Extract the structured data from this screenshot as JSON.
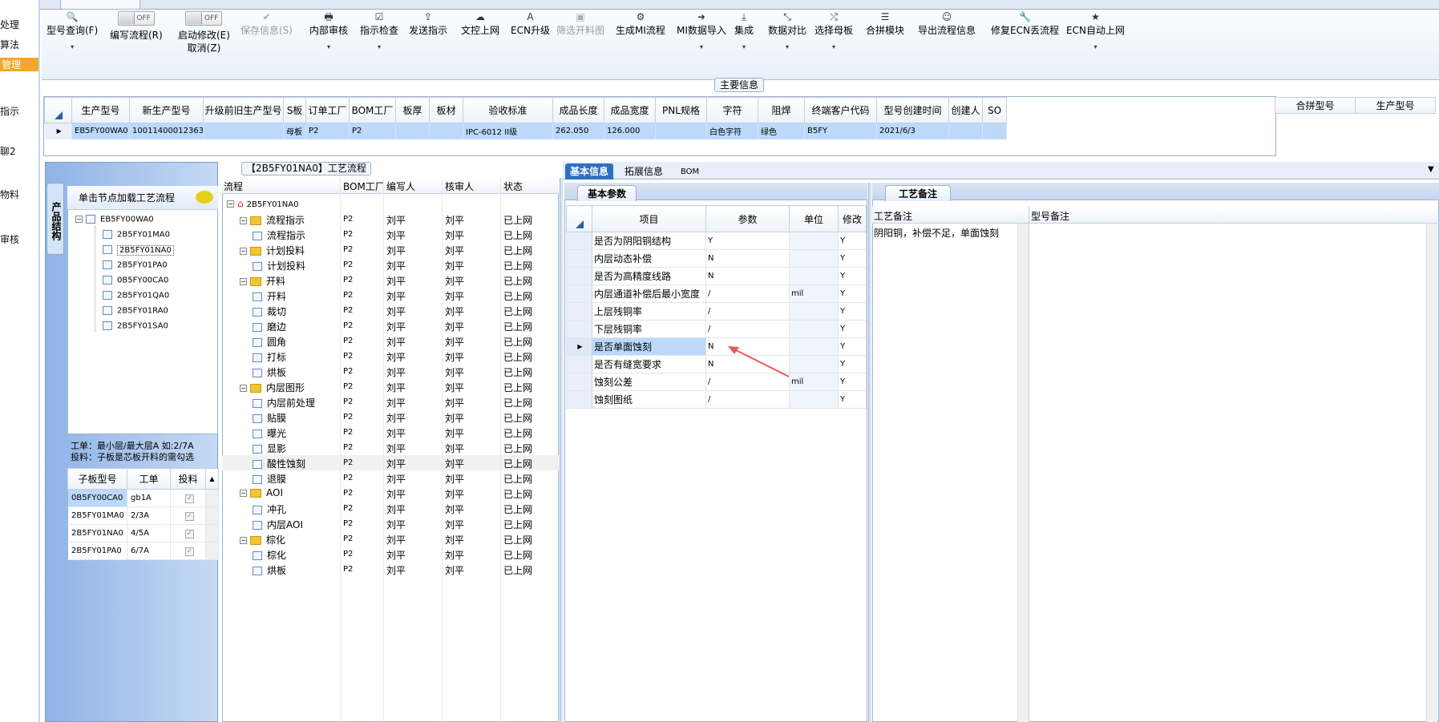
{
  "leftnav": {
    "items": [
      "处理",
      "算法",
      "管理",
      "指示",
      "聊2",
      "物料",
      "审核"
    ],
    "selected": "管理"
  },
  "toolbar": {
    "buttons": [
      {
        "icon": "search-icon",
        "glyph": "🔍",
        "label": "型号查询(F)",
        "arrow": "▾"
      },
      {
        "icon": "toggle",
        "glyph": "OFF",
        "label": "编写流程(R)"
      },
      {
        "icon": "toggle",
        "glyph": "OFF",
        "label": "启动修改(E)",
        "label2": "取消(Z)"
      },
      {
        "icon": "check-icon",
        "glyph": "✔",
        "label": "保存信息(S)",
        "disabled": true
      },
      {
        "icon": "print-icon",
        "glyph": "🖶",
        "label": "内部审核",
        "arrow": "▾"
      },
      {
        "icon": "checkbox-icon",
        "glyph": "☑",
        "label": "指示检查",
        "arrow": "▾"
      },
      {
        "icon": "upload-icon",
        "glyph": "⇪",
        "label": "发送指示"
      },
      {
        "icon": "cloud-upload-icon",
        "glyph": "☁",
        "label": "文控上网"
      },
      {
        "icon": "font-icon",
        "glyph": "A",
        "label": "ECN升级"
      },
      {
        "icon": "image-icon",
        "glyph": "▣",
        "label": "筛选开料图",
        "disabled": true
      },
      {
        "icon": "gears-icon",
        "glyph": "⚙",
        "label": "生成MI流程"
      },
      {
        "icon": "sign-in-icon",
        "glyph": "➜",
        "label": "MI数据导入",
        "arrow": "▾"
      },
      {
        "icon": "download-icon",
        "glyph": "⤓",
        "label": "集成",
        "arrow": "▾"
      },
      {
        "icon": "compress-icon",
        "glyph": "⤡",
        "label": "数据对比",
        "arrow": "▾"
      },
      {
        "icon": "shuffle-icon",
        "glyph": "⤮",
        "label": "选择母板",
        "arrow": "▾"
      },
      {
        "icon": "list-icon",
        "glyph": "☰",
        "label": "合拼模块"
      },
      {
        "icon": "smile-icon",
        "glyph": "☺",
        "label": "导出流程信息"
      },
      {
        "icon": "wrench-icon",
        "glyph": "🔧",
        "label": "修复ECN丢流程"
      },
      {
        "icon": "star-icon",
        "glyph": "★",
        "label": "ECN自动上网",
        "arrow": "▾"
      }
    ]
  },
  "main_info": {
    "title": "主要信息",
    "columns": [
      "生产型号",
      "新生产型号",
      "升级前旧生产型号",
      "S板",
      "订单工厂",
      "BOM工厂",
      "板厚",
      "板材",
      "验收标准",
      "成品长度",
      "成品宽度",
      "PNL规格",
      "字符",
      "阻焊",
      "终端客户代码",
      "型号创建时间",
      "创建人",
      "SO"
    ],
    "row": [
      "EB5FY00WA0",
      "10011400012363",
      "",
      "母板",
      "P2",
      "P2",
      "",
      "",
      "IPC-6012 II级",
      "262.050",
      "126.000",
      "",
      "白色字符",
      "绿色",
      "B5FY",
      "2021/6/3",
      "",
      ""
    ],
    "side_columns": [
      "合拼型号",
      "生产型号"
    ]
  },
  "struct_panel": {
    "tab_label": "产品结构",
    "hint": "单击节点加载工艺流程",
    "tree": [
      "EB5FY00WA0",
      "2B5FY01MA0",
      "2B5FY01NA0",
      "2B5FY01PA0",
      "0B5FY00CA0",
      "2B5FY01QA0",
      "2B5FY01RA0",
      "2B5FY01SA0"
    ],
    "note_line1": "工单：最小层/最大层A 如:2/7A",
    "note_line2": "投料：子板是芯板开料的需勾选",
    "sub_columns": [
      "子板型号",
      "工单",
      "投料"
    ],
    "sub_rows": [
      [
        "0B5FY00CA0",
        "gb1A"
      ],
      [
        "2B5FY01MA0",
        "2/3A"
      ],
      [
        "2B5FY01NA0",
        "4/5A"
      ],
      [
        "2B5FY01PA0",
        "6/7A"
      ]
    ]
  },
  "flow_panel": {
    "title": "【2B5FY01NA0】工艺流程",
    "columns": [
      "流程",
      "BOM工厂",
      "编写人",
      "核审人",
      "状态"
    ],
    "root": "2B5FY01NA0",
    "rows": [
      {
        "name": "流程指示",
        "level": 1,
        "folder": true,
        "bom": "P2",
        "writer": "刘平",
        "reviewer": "刘平",
        "status": "已上网"
      },
      {
        "name": "流程指示",
        "level": 2,
        "folder": false,
        "bom": "P2",
        "writer": "刘平",
        "reviewer": "刘平",
        "status": "已上网"
      },
      {
        "name": "计划投料",
        "level": 1,
        "folder": true,
        "bom": "P2",
        "writer": "刘平",
        "reviewer": "刘平",
        "status": "已上网"
      },
      {
        "name": "计划投料",
        "level": 2,
        "folder": false,
        "bom": "P2",
        "writer": "刘平",
        "reviewer": "刘平",
        "status": "已上网"
      },
      {
        "name": "开料",
        "level": 1,
        "folder": true,
        "bom": "P2",
        "writer": "刘平",
        "reviewer": "刘平",
        "status": "已上网"
      },
      {
        "name": "开料",
        "level": 2,
        "folder": false,
        "bom": "P2",
        "writer": "刘平",
        "reviewer": "刘平",
        "status": "已上网"
      },
      {
        "name": "裁切",
        "level": 2,
        "folder": false,
        "bom": "P2",
        "writer": "刘平",
        "reviewer": "刘平",
        "status": "已上网"
      },
      {
        "name": "磨边",
        "level": 2,
        "folder": false,
        "bom": "P2",
        "writer": "刘平",
        "reviewer": "刘平",
        "status": "已上网"
      },
      {
        "name": "圆角",
        "level": 2,
        "folder": false,
        "bom": "P2",
        "writer": "刘平",
        "reviewer": "刘平",
        "status": "已上网"
      },
      {
        "name": "打标",
        "level": 2,
        "folder": false,
        "bom": "P2",
        "writer": "刘平",
        "reviewer": "刘平",
        "status": "已上网"
      },
      {
        "name": "烘板",
        "level": 2,
        "folder": false,
        "bom": "P2",
        "writer": "刘平",
        "reviewer": "刘平",
        "status": "已上网"
      },
      {
        "name": "内层图形",
        "level": 1,
        "folder": true,
        "bom": "P2",
        "writer": "刘平",
        "reviewer": "刘平",
        "status": "已上网"
      },
      {
        "name": "内层前处理",
        "level": 2,
        "folder": false,
        "bom": "P2",
        "writer": "刘平",
        "reviewer": "刘平",
        "status": "已上网"
      },
      {
        "name": "贴膜",
        "level": 2,
        "folder": false,
        "bom": "P2",
        "writer": "刘平",
        "reviewer": "刘平",
        "status": "已上网"
      },
      {
        "name": "曝光",
        "level": 2,
        "folder": false,
        "bom": "P2",
        "writer": "刘平",
        "reviewer": "刘平",
        "status": "已上网"
      },
      {
        "name": "显影",
        "level": 2,
        "folder": false,
        "bom": "P2",
        "writer": "刘平",
        "reviewer": "刘平",
        "status": "已上网"
      },
      {
        "name": "酸性蚀刻",
        "level": 2,
        "folder": false,
        "bom": "P2",
        "writer": "刘平",
        "reviewer": "刘平",
        "status": "已上网",
        "selected": true
      },
      {
        "name": "退膜",
        "level": 2,
        "folder": false,
        "bom": "P2",
        "writer": "刘平",
        "reviewer": "刘平",
        "status": "已上网"
      },
      {
        "name": "AOI",
        "level": 1,
        "folder": true,
        "bom": "P2",
        "writer": "刘平",
        "reviewer": "刘平",
        "status": "已上网"
      },
      {
        "name": "冲孔",
        "level": 2,
        "folder": false,
        "bom": "P2",
        "writer": "刘平",
        "reviewer": "刘平",
        "status": "已上网"
      },
      {
        "name": "内层AOI",
        "level": 2,
        "folder": false,
        "bom": "P2",
        "writer": "刘平",
        "reviewer": "刘平",
        "status": "已上网"
      },
      {
        "name": "棕化",
        "level": 1,
        "folder": true,
        "bom": "P2",
        "writer": "刘平",
        "reviewer": "刘平",
        "status": "已上网"
      },
      {
        "name": "棕化",
        "level": 2,
        "folder": false,
        "bom": "P2",
        "writer": "刘平",
        "reviewer": "刘平",
        "status": "已上网"
      },
      {
        "name": "烘板",
        "level": 2,
        "folder": false,
        "bom": "P2",
        "writer": "刘平",
        "reviewer": "刘平",
        "status": "已上网"
      }
    ]
  },
  "right_tabs": {
    "items": [
      "基本信息",
      "拓展信息",
      "BOM"
    ],
    "active": "基本信息"
  },
  "basic_params": {
    "title": "基本参数",
    "columns": [
      "项目",
      "参数",
      "单位",
      "修改"
    ],
    "rows": [
      [
        "是否为阴阳铜结构",
        "Y",
        "",
        "Y"
      ],
      [
        "内层动态补偿",
        "N",
        "",
        "Y"
      ],
      [
        "是否为高精度线路",
        "N",
        "",
        "Y"
      ],
      [
        "内层通道补偿后最小宽度",
        "/",
        "mil",
        "Y"
      ],
      [
        "上层残铜率",
        "/",
        "",
        "Y"
      ],
      [
        "下层残铜率",
        "/",
        "",
        "Y"
      ],
      [
        "是否单面蚀刻",
        "N",
        "",
        "Y"
      ],
      [
        "是否有缝宽要求",
        "N",
        "",
        "Y"
      ],
      [
        "蚀刻公差",
        "/",
        "mil",
        "Y"
      ],
      [
        "蚀刻图纸",
        "/",
        "",
        "Y"
      ]
    ],
    "selected_row": 6
  },
  "process_notes": {
    "title": "工艺备注",
    "columns": [
      "工艺备注",
      "型号备注"
    ],
    "note": "阴阳铜，补偿不足，单面蚀刻"
  },
  "colors": {
    "accent": "#2f6fc2",
    "selected_row": "#bcd9fb",
    "nav_selected": "#f5a62a",
    "arrow": "#e85a5a"
  }
}
